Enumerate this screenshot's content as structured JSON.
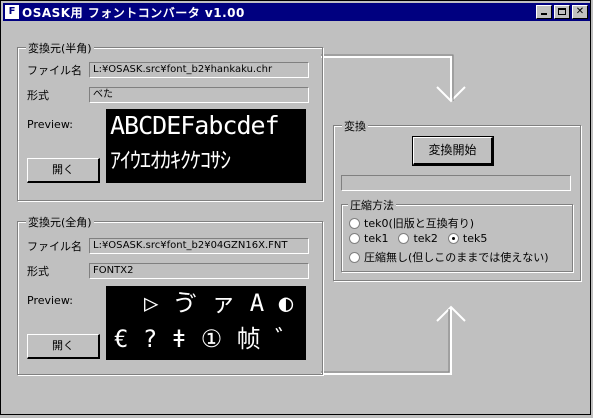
{
  "window": {
    "title": "OSASK用 フォントコンバータ  v1.00",
    "icon_label": "F"
  },
  "half_group": {
    "title": "変換元(半角)",
    "file_label": "ファイル名",
    "file_value": "L:¥OSASK.src¥font_b2¥hankaku.chr",
    "format_label": "形式",
    "format_value": "べた",
    "preview_label": "Preview:",
    "preview_line1": "ABCDEFabcdef",
    "preview_line2": "ｱｲｳｴｵｶｷｸｹｺｻｼ",
    "open_button": "開く"
  },
  "full_group": {
    "title": "変換元(全角)",
    "file_label": "ファイル名",
    "file_value": "L:¥OSASK.src¥font_b2¥04GZN16X.FNT",
    "format_label": "形式",
    "format_value": "FONTX2",
    "preview_label": "Preview:",
    "preview_line1": "▷ ゔ ァ A ◐",
    "preview_line2": "€ ? ǂ ① 帧 ゛",
    "open_button": "開く"
  },
  "convert_group": {
    "title": "変換",
    "start_button": "変換開始",
    "progress": 0,
    "compress_title": "圧縮方法",
    "options": {
      "tek0": "tek0(旧版と互換有り)",
      "tek1": "tek1",
      "tek2": "tek2",
      "tek5": "tek5",
      "none": "圧縮無し(但しこのままでは使えない)"
    },
    "selected": "tek5"
  }
}
